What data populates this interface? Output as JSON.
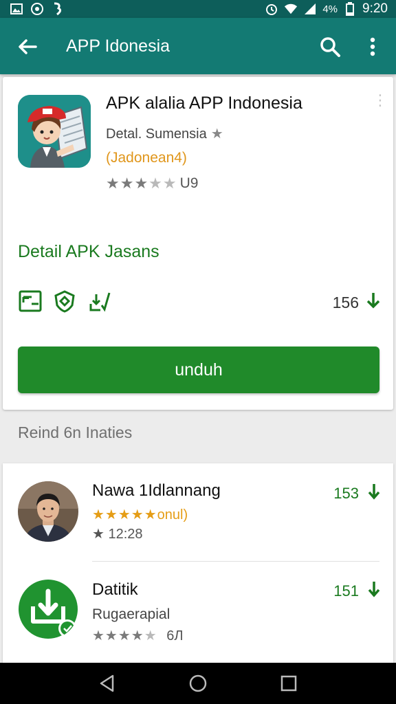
{
  "status_bar": {
    "battery_text": "4%",
    "time": "9:20",
    "icons": [
      "image-icon",
      "whatsapp-icon",
      "app-icon",
      "alarm-icon",
      "wifi-icon",
      "signal-icon",
      "battery-icon"
    ]
  },
  "app_bar": {
    "title": "APP Idonesia",
    "icons": [
      "back-arrow-icon",
      "search-icon",
      "more-vert-icon"
    ]
  },
  "app": {
    "title": "APK alalia APP Indonesia",
    "developer": "Detal. Sumensia",
    "developer_star": "★",
    "category": "(Jadonean4)",
    "rating_value": 3.5,
    "rating_text": "U9"
  },
  "details": {
    "title": "Detail APK Jasans",
    "download_count": "156",
    "install_label": "unduh",
    "feature_icons": [
      "screen-icon",
      "shield-icon",
      "download-check-icon"
    ]
  },
  "related": {
    "title": "Reind 6n Inaties",
    "items": [
      {
        "name": "Nawa 1Idlannang",
        "stars": "★★★★★",
        "sub": "onul)",
        "meta": "★ 12:28",
        "count": "153"
      },
      {
        "name": "Datitik",
        "developer": "Rugaerapial",
        "rating_value": 4,
        "meta_text": "6Л",
        "count": "151"
      }
    ]
  },
  "colors": {
    "status_bar": "#0d5e5a",
    "app_bar": "#137a73",
    "accent_green": "#208a2a",
    "orange": "#e59d16"
  }
}
